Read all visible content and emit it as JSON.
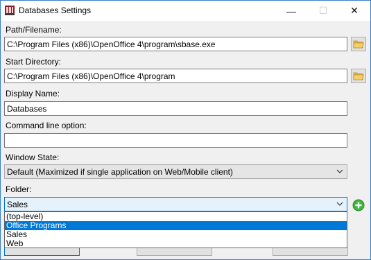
{
  "window": {
    "title": "Databases Settings",
    "minimize_glyph": "—",
    "maximize_glyph": "☐",
    "close_glyph": "✕"
  },
  "fields": {
    "path_label": "Path/Filename:",
    "path_value": "C:\\Program Files (x86)\\OpenOffice 4\\program\\sbase.exe",
    "start_dir_label": "Start Directory:",
    "start_dir_value": "C:\\Program Files (x86)\\OpenOffice 4\\program",
    "display_name_label": "Display Name:",
    "display_name_value": "Databases",
    "cmd_label": "Command line option:",
    "cmd_value": "",
    "window_state_label": "Window State:",
    "window_state_value": "Default (Maximized if single application on Web/Mobile client)",
    "folder_label": "Folder:",
    "folder_value": "Sales"
  },
  "folder_options": [
    "(top-level)",
    "Office Programs",
    "Sales",
    "Web"
  ],
  "highlighted_option": "Office Programs",
  "icons": {
    "app": "database-app-icon",
    "browse": "folder-icon",
    "add": "add-circle-icon",
    "arrow": "chevron-down-icon"
  },
  "colors": {
    "highlight": "#0078d7",
    "add_green": "#3fb53f",
    "folder_yellow": "#e8b640"
  }
}
